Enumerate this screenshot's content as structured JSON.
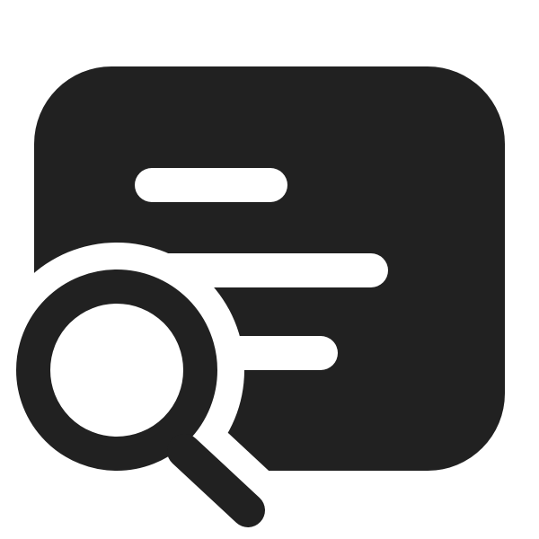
{
  "icon": {
    "name": "document-search-icon",
    "background_color": "#ffffff",
    "primary_color": "#212121",
    "lens_fill_color": "#ffffff"
  }
}
